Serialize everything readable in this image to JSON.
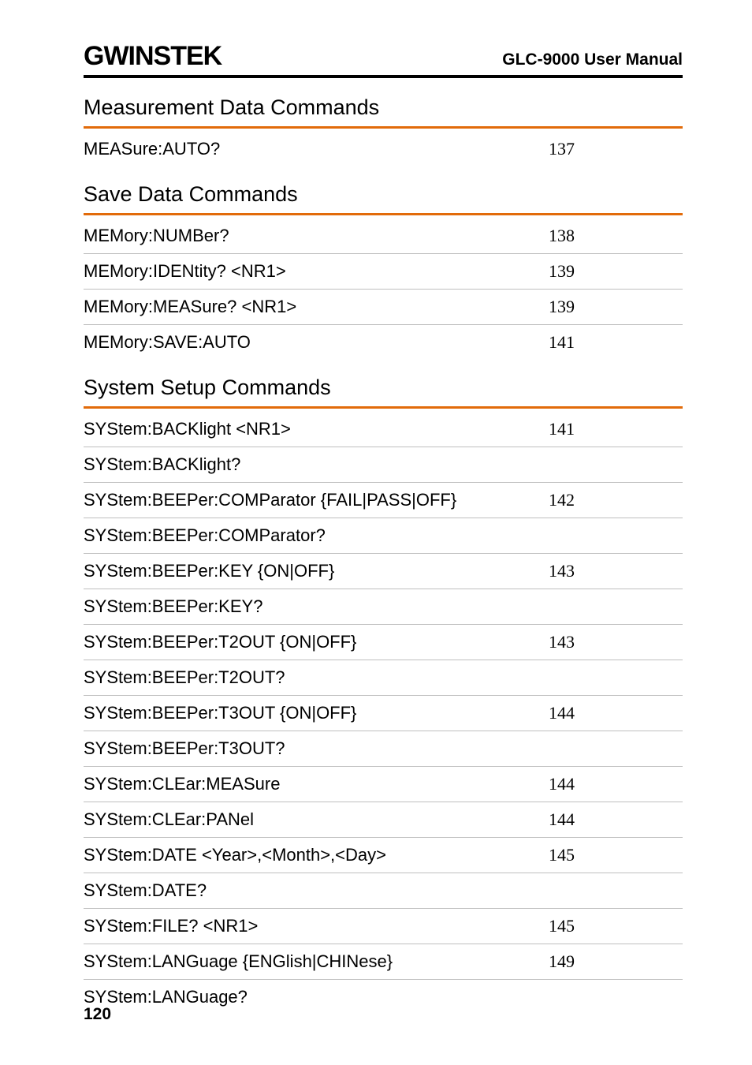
{
  "header": {
    "brand": "GWINSTEK",
    "manual": "GLC-9000 User Manual"
  },
  "sections": [
    {
      "title": "Measurement Data Commands",
      "rows": [
        {
          "cmd": "MEASure:AUTO?",
          "page": "137"
        }
      ]
    },
    {
      "title": "Save Data Commands",
      "rows": [
        {
          "cmd": "MEMory:NUMBer?",
          "page": "138"
        },
        {
          "cmd": "MEMory:IDENtity? <NR1>",
          "page": "139"
        },
        {
          "cmd": "MEMory:MEASure? <NR1>",
          "page": "139"
        },
        {
          "cmd": "MEMory:SAVE:AUTO",
          "page": "141"
        }
      ]
    },
    {
      "title": "System Setup Commands",
      "rows": [
        {
          "cmd": "SYStem:BACKlight <NR1>",
          "page": "141"
        },
        {
          "cmd": "SYStem:BACKlight?",
          "page": ""
        },
        {
          "cmd": "SYStem:BEEPer:COMParator {FAIL|PASS|OFF}",
          "page": "142"
        },
        {
          "cmd": "SYStem:BEEPer:COMParator?",
          "page": ""
        },
        {
          "cmd": "SYStem:BEEPer:KEY {ON|OFF}",
          "page": "143"
        },
        {
          "cmd": "SYStem:BEEPer:KEY?",
          "page": ""
        },
        {
          "cmd": "SYStem:BEEPer:T2OUT {ON|OFF}",
          "page": "143"
        },
        {
          "cmd": "SYStem:BEEPer:T2OUT?",
          "page": ""
        },
        {
          "cmd": "SYStem:BEEPer:T3OUT {ON|OFF}",
          "page": "144"
        },
        {
          "cmd": "SYStem:BEEPer:T3OUT?",
          "page": ""
        },
        {
          "cmd": "SYStem:CLEar:MEASure",
          "page": "144"
        },
        {
          "cmd": "SYStem:CLEar:PANel",
          "page": "144"
        },
        {
          "cmd": "SYStem:DATE <Year>,<Month>,<Day>",
          "page": "145"
        },
        {
          "cmd": "SYStem:DATE?",
          "page": ""
        },
        {
          "cmd": "SYStem:FILE? <NR1>",
          "page": "145"
        },
        {
          "cmd": "SYStem:LANGuage {ENGlish|CHINese}",
          "page": "149"
        },
        {
          "cmd": "SYStem:LANGuage?",
          "page": ""
        }
      ]
    }
  ],
  "page_number": "120"
}
